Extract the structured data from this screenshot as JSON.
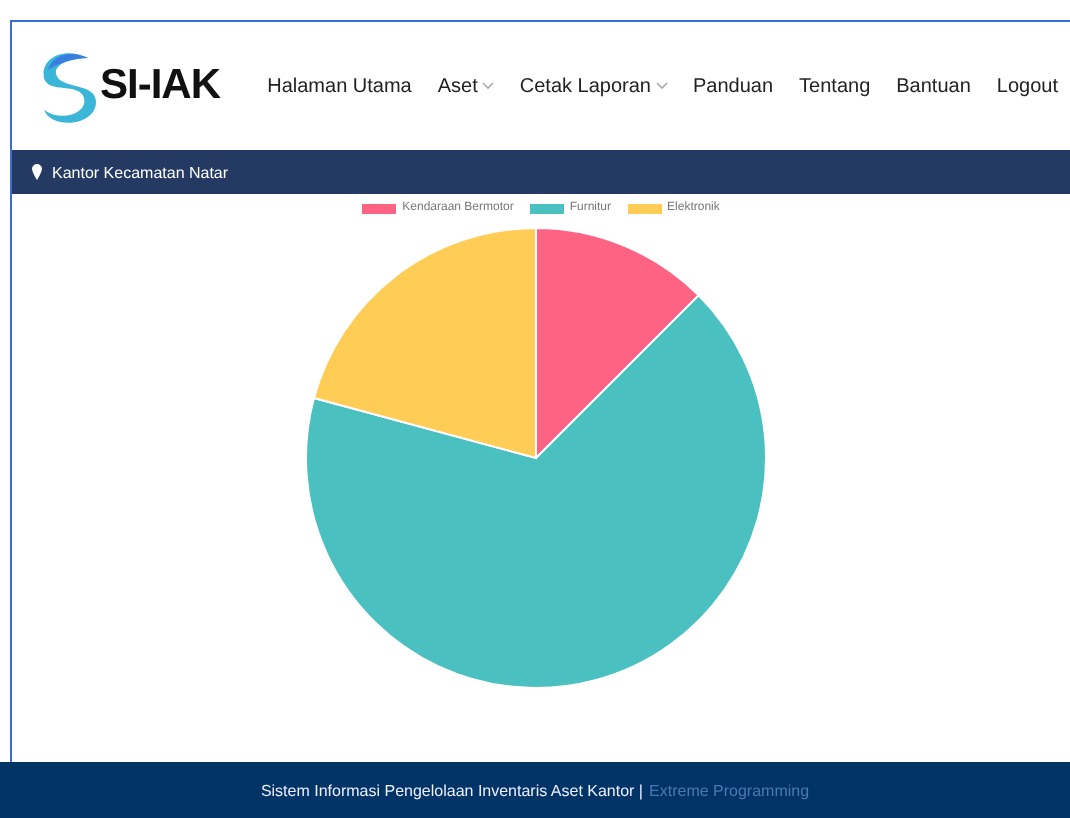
{
  "header": {
    "logo_text": "SI-IAK",
    "nav": [
      {
        "label": "Halaman Utama",
        "dropdown": false
      },
      {
        "label": "Aset",
        "dropdown": true
      },
      {
        "label": "Cetak Laporan",
        "dropdown": true
      },
      {
        "label": "Panduan",
        "dropdown": false
      },
      {
        "label": "Tentang",
        "dropdown": false
      },
      {
        "label": "Bantuan",
        "dropdown": false
      },
      {
        "label": "Logout",
        "dropdown": false
      }
    ]
  },
  "location_bar": {
    "text": "Kantor Kecamatan Natar"
  },
  "chart_data": {
    "type": "pie",
    "legend": true,
    "categories": [
      "Kendaraan Bermotor",
      "Furnitur",
      "Elektronik"
    ],
    "series": [
      {
        "colors": [
          "#ff6384",
          "#4bc0c0",
          "#ffcd56"
        ],
        "values": [
          12.5,
          66.7,
          20.8
        ]
      }
    ]
  },
  "footer": {
    "text": "Sistem Informasi Pengelolaan Inventaris Aset Kantor |",
    "link": "Extreme Programming"
  }
}
